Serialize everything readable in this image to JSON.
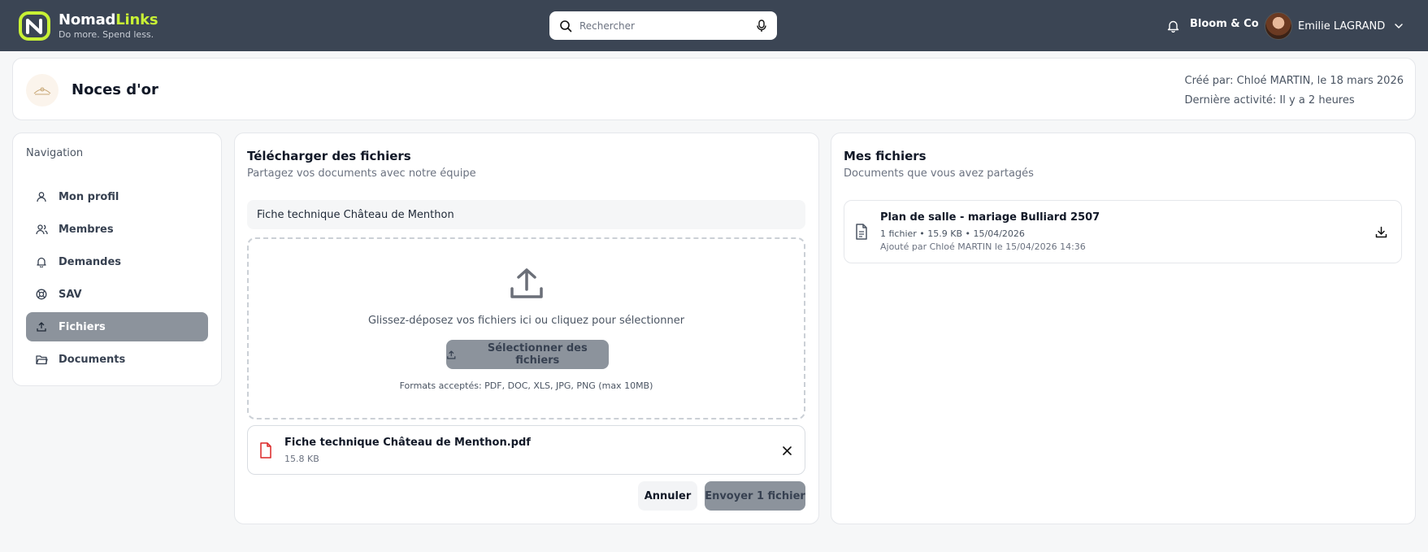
{
  "brand": {
    "name_part1": "Nomad",
    "name_part2": "Links",
    "tagline": "Do more. Spend less.",
    "accent_color": "#c8f135"
  },
  "search": {
    "placeholder": "Rechercher"
  },
  "header": {
    "company": "Bloom & Co",
    "user_name": "Emilie LAGRAND"
  },
  "project": {
    "title": "Noces d'or",
    "created_by": "Créé par: Chloé MARTIN, le 18 mars 2026",
    "last_activity": "Dernière activité: Il y a 2 heures"
  },
  "sidebar": {
    "title": "Navigation",
    "items": [
      {
        "label": "Mon profil",
        "icon": "user-icon"
      },
      {
        "label": "Membres",
        "icon": "users-icon"
      },
      {
        "label": "Demandes",
        "icon": "bell-icon"
      },
      {
        "label": "SAV",
        "icon": "lifebuoy-icon"
      },
      {
        "label": "Fichiers",
        "icon": "upload-icon",
        "active": true
      },
      {
        "label": "Documents",
        "icon": "folder-icon"
      }
    ]
  },
  "upload": {
    "title": "Télécharger des fichiers",
    "subtitle": "Partagez vos documents avec notre équipe",
    "name_value": "Fiche technique Château de Menthon",
    "drop_text": "Glissez-déposez vos fichiers ici ou cliquez pour sélectionner",
    "select_button": "Sélectionner des fichiers",
    "formats": "Formats acceptés: PDF, DOC, XLS, JPG, PNG (max 10MB)",
    "selected_file": {
      "name": "Fiche technique Château de Menthon.pdf",
      "size": "15.8 KB"
    },
    "cancel_button": "Annuler",
    "send_button": "Envoyer 1 fichier"
  },
  "my_files": {
    "title": "Mes fichiers",
    "subtitle": "Documents que vous avez partagés",
    "items": [
      {
        "title": "Plan de salle - mariage Bulliard 2507",
        "info": "1 fichier • 15.9 KB • 15/04/2026",
        "added": "Ajouté par Chloé MARTIN le 15/04/2026 14:36"
      }
    ]
  }
}
